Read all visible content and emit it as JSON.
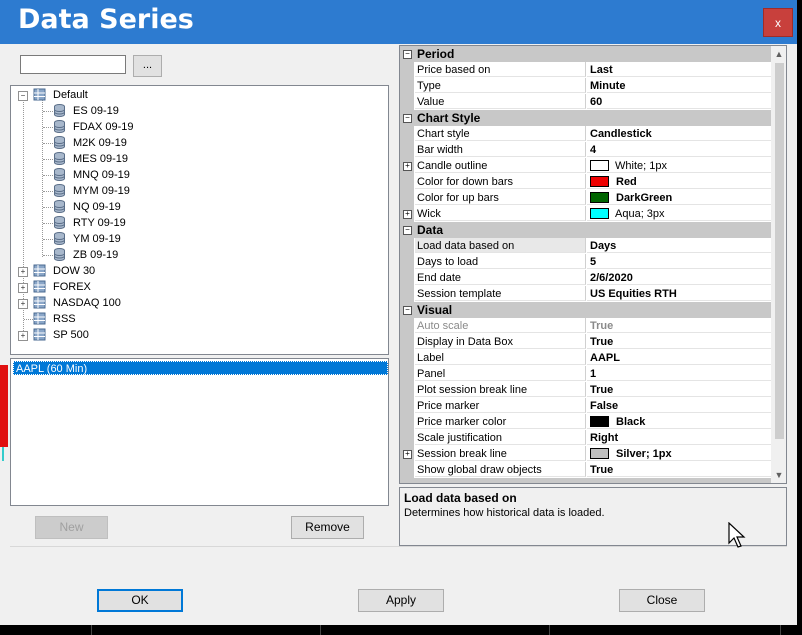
{
  "window": {
    "title": "Data Series",
    "close_label": "x"
  },
  "instrument_search": {
    "value": "",
    "browse_label": "..."
  },
  "tree": {
    "default_label": "Default",
    "default_children": [
      "ES 09-19",
      "FDAX 09-19",
      "M2K 09-19",
      "MES 09-19",
      "MNQ 09-19",
      "MYM 09-19",
      "NQ 09-19",
      "RTY 09-19",
      "YM 09-19",
      "ZB 09-19"
    ],
    "other_lists": [
      "DOW 30",
      "FOREX",
      "NASDAQ 100",
      "RSS",
      "SP 500"
    ]
  },
  "selected_series": [
    "AAPL (60 Min)"
  ],
  "buttons": {
    "new": "New",
    "remove": "Remove",
    "ok": "OK",
    "apply": "Apply",
    "close": "Close"
  },
  "properties": {
    "period": {
      "label": "Period",
      "rows": [
        {
          "name": "Price based on",
          "value": "Last"
        },
        {
          "name": "Type",
          "value": "Minute"
        },
        {
          "name": "Value",
          "value": "60"
        }
      ]
    },
    "chart_style": {
      "label": "Chart Style",
      "rows": [
        {
          "name": "Chart style",
          "value": "Candlestick"
        },
        {
          "name": "Bar width",
          "value": "4"
        },
        {
          "name": "Candle outline",
          "value": "White; 1px",
          "swatch": "#ffffff"
        },
        {
          "name": "Color for down bars",
          "value": "Red",
          "swatch": "#ee0000"
        },
        {
          "name": "Color for up bars",
          "value": "DarkGreen",
          "swatch": "#006400"
        },
        {
          "name": "Wick",
          "value": "Aqua; 3px",
          "swatch": "#00ffff"
        }
      ]
    },
    "data": {
      "label": "Data",
      "rows": [
        {
          "name": "Load data based on",
          "value": "Days"
        },
        {
          "name": "Days to load",
          "value": "5"
        },
        {
          "name": "End date",
          "value": "2/6/2020"
        },
        {
          "name": "Session template",
          "value": "US Equities RTH"
        }
      ]
    },
    "visual": {
      "label": "Visual",
      "rows": [
        {
          "name": "Auto scale",
          "value": "True"
        },
        {
          "name": "Display in Data Box",
          "value": "True"
        },
        {
          "name": "Label",
          "value": "AAPL"
        },
        {
          "name": "Panel",
          "value": "1"
        },
        {
          "name": "Plot session break line",
          "value": "True"
        },
        {
          "name": "Price marker",
          "value": "False"
        },
        {
          "name": "Price marker color",
          "value": "Black",
          "swatch": "#000000"
        },
        {
          "name": "Scale justification",
          "value": "Right"
        },
        {
          "name": "Session break line",
          "value": "Silver; 1px",
          "swatch": "#c0c0c0"
        },
        {
          "name": "Show global draw objects",
          "value": "True"
        }
      ]
    }
  },
  "description": {
    "title": "Load data based on",
    "text": "Determines how historical data is loaded."
  }
}
